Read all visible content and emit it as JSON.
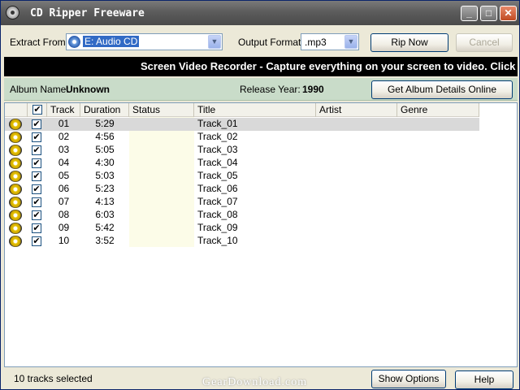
{
  "window": {
    "title": "CD Ripper Freeware"
  },
  "toolbar": {
    "extract_from_label": "Extract From:",
    "extract_from_value": "E:  Audio CD",
    "output_format_label": "Output Format:",
    "output_format_value": ".mp3",
    "rip_now_label": "Rip Now",
    "cancel_label": "Cancel"
  },
  "banner": {
    "text": "Screen Video Recorder - Capture everything on your screen to video. Click for mo"
  },
  "album": {
    "album_name_label": "Album Name:",
    "album_name_value": "Unknown",
    "release_year_label": "Release Year:",
    "release_year_value": "1990",
    "get_details_label": "Get Album Details Online"
  },
  "grid": {
    "columns": [
      "Track",
      "Duration",
      "Status",
      "Title",
      "Artist",
      "Genre"
    ],
    "rows": [
      {
        "track": "01",
        "duration": "5:29",
        "title": "Track_01"
      },
      {
        "track": "02",
        "duration": "4:56",
        "title": "Track_02"
      },
      {
        "track": "03",
        "duration": "5:05",
        "title": "Track_03"
      },
      {
        "track": "04",
        "duration": "4:30",
        "title": "Track_04"
      },
      {
        "track": "05",
        "duration": "5:03",
        "title": "Track_05"
      },
      {
        "track": "06",
        "duration": "5:23",
        "title": "Track_06"
      },
      {
        "track": "07",
        "duration": "4:13",
        "title": "Track_07"
      },
      {
        "track": "08",
        "duration": "6:03",
        "title": "Track_08"
      },
      {
        "track": "09",
        "duration": "5:42",
        "title": "Track_09"
      },
      {
        "track": "10",
        "duration": "3:52",
        "title": "Track_10"
      }
    ]
  },
  "footer": {
    "status_text": "10 tracks selected",
    "show_options_label": "Show Options",
    "help_label": "Help",
    "watermark": "GearDownload.com"
  },
  "icons": {
    "checkbox_mark": "✔",
    "dropdown_arrow": "▼"
  }
}
